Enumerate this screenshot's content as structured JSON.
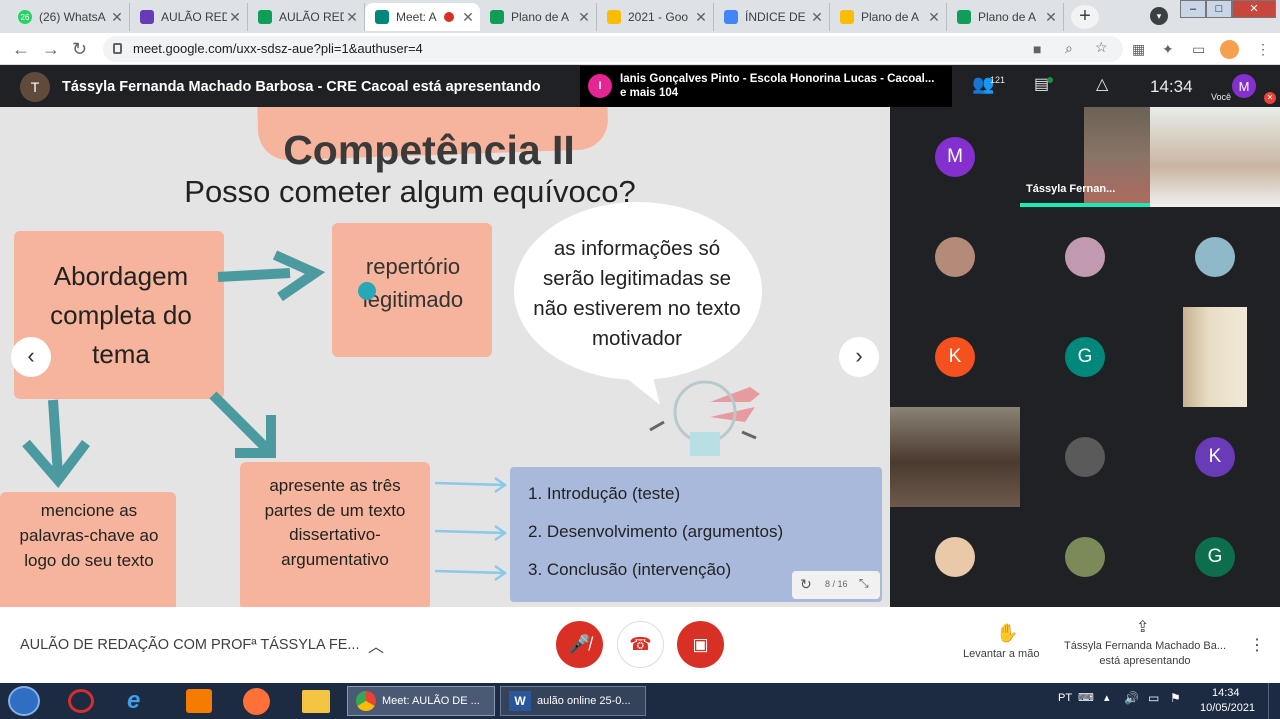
{
  "tabs": [
    {
      "title": "(26) WhatsA",
      "color": "#25d366",
      "badge": "26"
    },
    {
      "title": "AULÃO RED",
      "color": "#673ab7",
      "badge": ""
    },
    {
      "title": "AULÃO RED",
      "color": "#0f9d58",
      "badge": ""
    },
    {
      "title": "Meet: A",
      "color": "#00897b",
      "badge": ""
    },
    {
      "title": "Plano de A",
      "color": "#0f9d58",
      "badge": ""
    },
    {
      "title": "2021 - Goo",
      "color": "#fbbc04",
      "badge": ""
    },
    {
      "title": "ÍNDICE DE",
      "color": "#4285f4",
      "badge": ""
    },
    {
      "title": "Plano de A",
      "color": "#fbbc04",
      "badge": ""
    },
    {
      "title": "Plano de A",
      "color": "#0f9d58",
      "badge": ""
    }
  ],
  "url": "meet.google.com/uxx-sdsz-aue?pli=1&authuser=4",
  "presenter": {
    "initial": "T",
    "text": "Tássyla Fernanda Machado Barbosa - CRE Cacoal está apresentando"
  },
  "notification": {
    "initial": "I",
    "line1": "Ianis Gonçalves Pinto - Escola Honorina Lucas - Cacoal...",
    "line2": "e mais 104"
  },
  "participants_count": "121",
  "clock": "14:34",
  "you_label": "Você",
  "you_initial": "M",
  "slide": {
    "title": "Competência II",
    "subtitle": "Posso cometer algum equívoco?",
    "box_main": "Abordagem completa do tema",
    "box_rep": "repertório legitimado",
    "bubble": "as informações só serão legitimadas se não estiverem no texto motivador",
    "box_keywords": "mencione as palavras-chave ao logo do seu texto",
    "box_parts": "apresente as três partes de um texto dissertativo-argumentativo",
    "list": [
      "1. Introdução (teste)",
      "2. Desenvolvimento (argumentos)",
      "3. Conclusão (intervenção)"
    ],
    "page": "8 / 16"
  },
  "tiles": [
    {
      "type": "initial",
      "initial": "M",
      "color": "#8430ce"
    },
    {
      "type": "video",
      "label": "Tássyla Fernan..."
    },
    {
      "type": "video",
      "label": ""
    },
    {
      "type": "photo",
      "color": "#b48a78"
    },
    {
      "type": "photo",
      "color": "#c29ab0"
    },
    {
      "type": "photo",
      "color": "#8fb9c9"
    },
    {
      "type": "initial",
      "initial": "K",
      "color": "#f4511e"
    },
    {
      "type": "initial",
      "initial": "G",
      "color": "#00897b"
    },
    {
      "type": "video",
      "label": ""
    },
    {
      "type": "video",
      "label": ""
    },
    {
      "type": "photo",
      "color": "#5a5a5a"
    },
    {
      "type": "initial",
      "initial": "K",
      "color": "#6a3bb8"
    },
    {
      "type": "photo",
      "color": "#e9c9a8"
    },
    {
      "type": "photo",
      "color": "#7c8a5a"
    },
    {
      "type": "initial",
      "initial": "G",
      "color": "#0d6e4e"
    }
  ],
  "meeting_title": "AULÃO DE REDAÇÃO COM PROFª TÁSSYLA FE...",
  "raise_hand": "Levantar a mão",
  "presenting_line1": "Tássyla Fernanda Machado Ba...",
  "presenting_line2": "está apresentando",
  "taskbar": {
    "meet_btn": "Meet: AULÃO DE ...",
    "word_btn": "aulão online 25-0...",
    "lang": "PT",
    "time": "14:34",
    "date": "10/05/2021"
  }
}
